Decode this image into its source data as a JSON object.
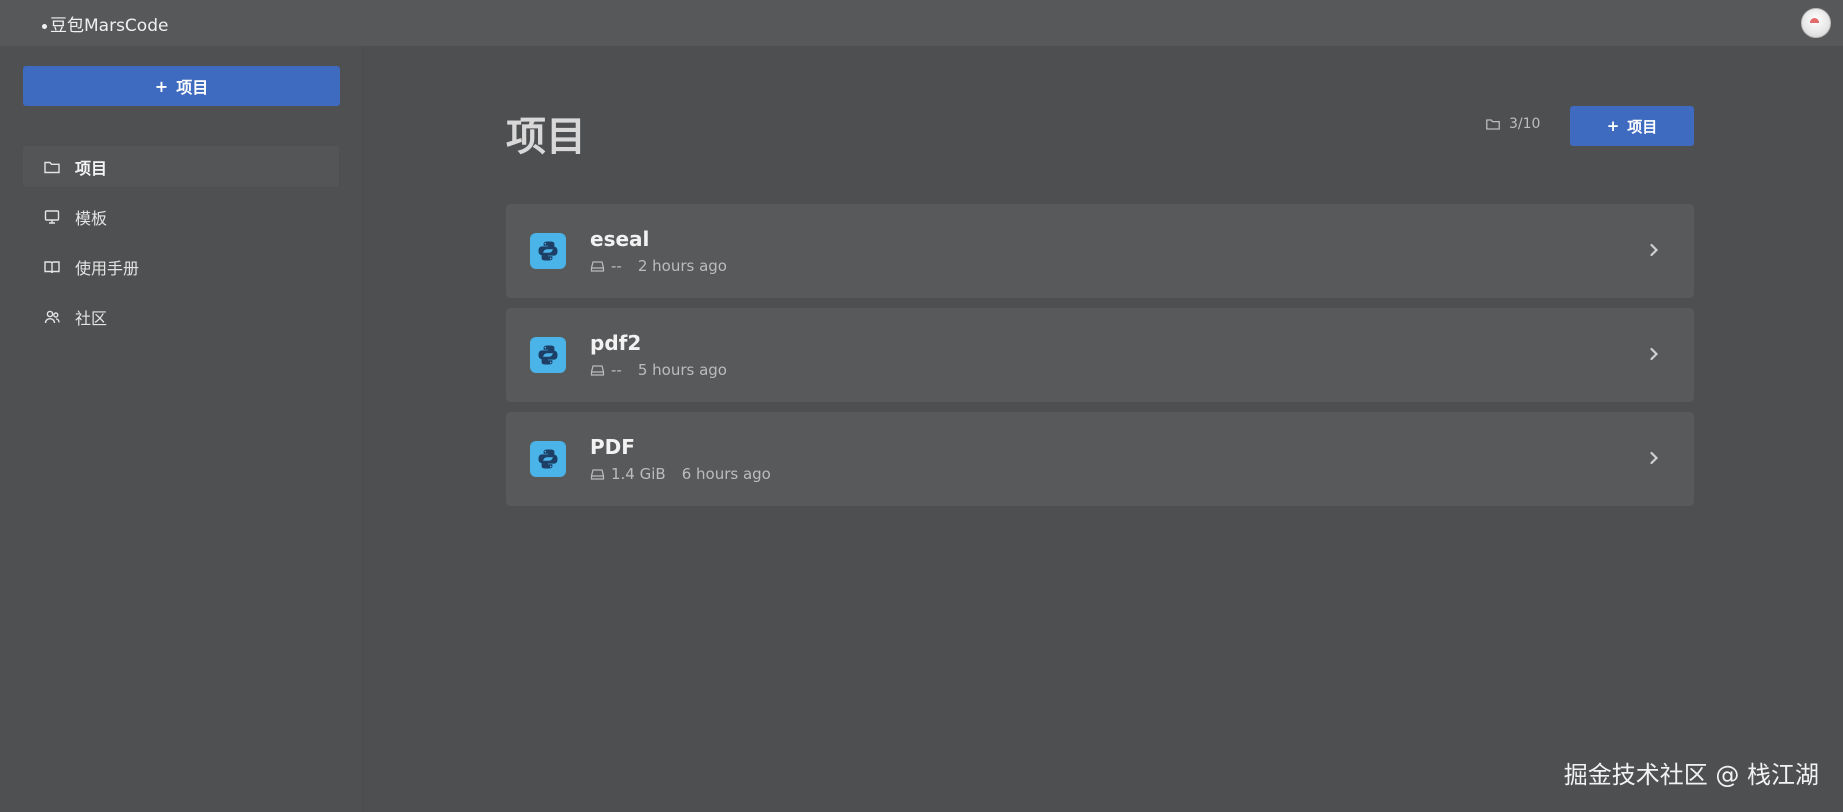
{
  "app": {
    "brand": "豆包MarsCode"
  },
  "sidebar": {
    "new_button_label": "项目",
    "items": [
      {
        "label": "项目",
        "icon": "folder-icon",
        "active": true
      },
      {
        "label": "模板",
        "icon": "monitor-icon",
        "active": false
      },
      {
        "label": "使用手册",
        "icon": "book-icon",
        "active": false
      },
      {
        "label": "社区",
        "icon": "users-icon",
        "active": false
      }
    ]
  },
  "main": {
    "title": "项目",
    "project_count": "3/10",
    "new_button_label": "项目",
    "projects": [
      {
        "name": "eseal",
        "size": "--",
        "updated": "2 hours ago",
        "icon": "python-icon"
      },
      {
        "name": "pdf2",
        "size": "--",
        "updated": "5 hours ago",
        "icon": "python-icon"
      },
      {
        "name": "PDF",
        "size": "1.4 GiB",
        "updated": "6 hours ago",
        "icon": "python-icon"
      }
    ]
  },
  "watermark": "掘金技术社区 @ 栈江湖",
  "colors": {
    "accent": "#3e6ac0",
    "background": "#4e4f51",
    "card": "#58595b",
    "python": "#4ab3e8"
  }
}
